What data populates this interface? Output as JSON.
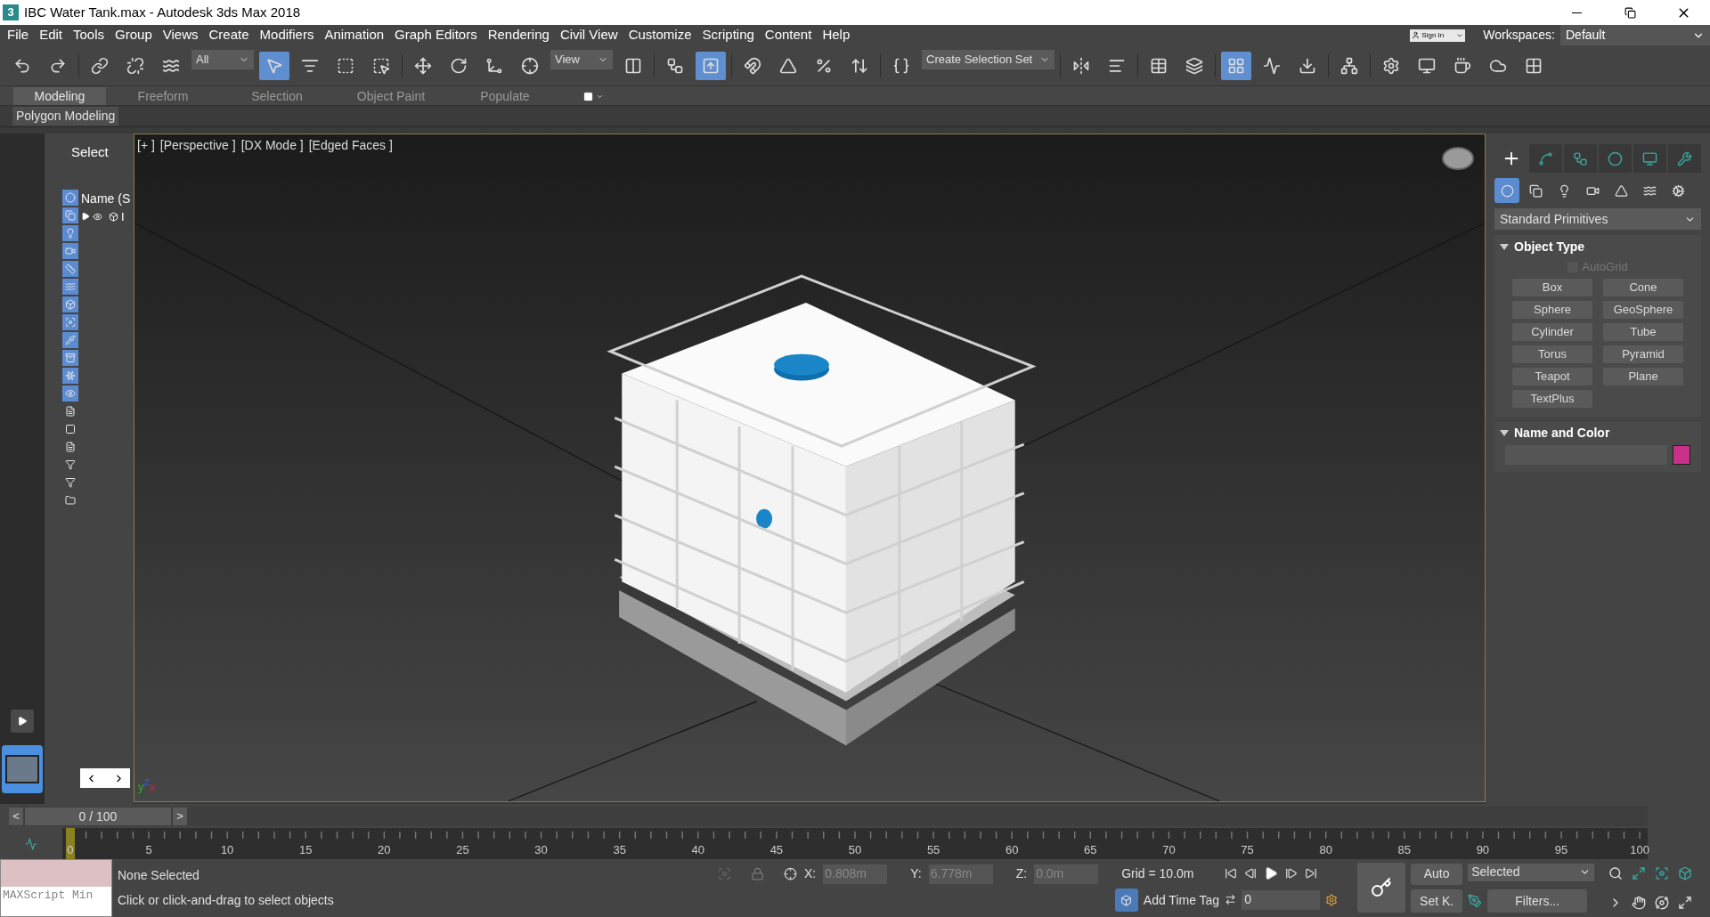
{
  "window": {
    "logo": "3",
    "title": "IBC Water Tank.max - Autodesk 3ds Max 2018"
  },
  "menu": [
    "File",
    "Edit",
    "Tools",
    "Group",
    "Views",
    "Create",
    "Modifiers",
    "Animation",
    "Graph Editors",
    "Rendering",
    "Civil View",
    "Customize",
    "Scripting",
    "Content",
    "Help"
  ],
  "account": {
    "sign_in": "Sign In",
    "workspaces_label": "Workspaces:",
    "workspace": "Default"
  },
  "toolbar": [
    {
      "kind": "tool",
      "selected": false
    },
    {
      "kind": "tool",
      "selected": false
    },
    {
      "kind": "divider"
    },
    {
      "kind": "tool",
      "selected": false
    },
    {
      "kind": "tool",
      "selected": false
    },
    {
      "kind": "tool",
      "selected": false
    },
    {
      "kind": "dropdown",
      "value": "All"
    },
    {
      "kind": "tool",
      "selected": true
    },
    {
      "kind": "tool",
      "selected": false
    },
    {
      "kind": "tool",
      "selected": false
    },
    {
      "kind": "tool",
      "selected": false
    },
    {
      "kind": "divider"
    },
    {
      "kind": "tool",
      "selected": false
    },
    {
      "kind": "tool",
      "selected": false
    },
    {
      "kind": "tool",
      "selected": false
    },
    {
      "kind": "tool",
      "selected": false
    },
    {
      "kind": "dropdown",
      "value": "View"
    },
    {
      "kind": "tool",
      "selected": false
    },
    {
      "kind": "divider"
    },
    {
      "kind": "tool",
      "selected": false
    },
    {
      "kind": "tool",
      "selected": true
    },
    {
      "kind": "divider"
    },
    {
      "kind": "tool",
      "selected": false
    },
    {
      "kind": "tool",
      "selected": false
    },
    {
      "kind": "tool",
      "selected": false
    },
    {
      "kind": "tool",
      "selected": false
    },
    {
      "kind": "divider"
    },
    {
      "kind": "tool",
      "selected": false
    },
    {
      "kind": "dropdown",
      "value": "Create Selection Set"
    },
    {
      "kind": "divider"
    },
    {
      "kind": "tool",
      "selected": false
    },
    {
      "kind": "tool",
      "selected": false
    },
    {
      "kind": "divider"
    },
    {
      "kind": "tool",
      "selected": false
    },
    {
      "kind": "tool",
      "selected": false
    },
    {
      "kind": "divider"
    },
    {
      "kind": "tool",
      "selected": true
    },
    {
      "kind": "tool",
      "selected": false
    },
    {
      "kind": "tool",
      "selected": false
    },
    {
      "kind": "divider"
    },
    {
      "kind": "tool",
      "selected": false
    },
    {
      "kind": "divider"
    },
    {
      "kind": "tool",
      "selected": false
    },
    {
      "kind": "tool",
      "selected": false
    },
    {
      "kind": "tool",
      "selected": false
    },
    {
      "kind": "tool",
      "selected": false
    },
    {
      "kind": "tool",
      "selected": false
    }
  ],
  "ribbon": {
    "tabs": [
      {
        "label": "Modeling",
        "selected": true
      },
      {
        "label": "Freeform",
        "selected": false
      },
      {
        "label": "Selection",
        "selected": false
      },
      {
        "label": "Object Paint",
        "selected": false
      },
      {
        "label": "Populate",
        "selected": false
      }
    ],
    "panel": "Polygon Modeling"
  },
  "scene_explorer": {
    "title": "Select",
    "column": "Name (S",
    "row": "I",
    "filters": [
      {
        "selected": true
      },
      {
        "selected": true
      },
      {
        "selected": true
      },
      {
        "selected": true
      },
      {
        "selected": true
      },
      {
        "selected": true
      },
      {
        "selected": true
      },
      {
        "selected": true
      },
      {
        "selected": true
      },
      {
        "selected": true
      },
      {
        "selected": true
      },
      {
        "selected": true
      },
      {
        "selected": false
      },
      {
        "selected": false
      },
      {
        "selected": false
      },
      {
        "selected": false
      },
      {
        "selected": false
      },
      {
        "selected": false
      }
    ]
  },
  "viewport": {
    "labels": [
      "[+ ]",
      "[Perspective ]",
      "[DX Mode ]",
      "[Edged Faces ]"
    ],
    "axes": [
      "y",
      "z",
      "x"
    ]
  },
  "command_panel": {
    "tabs": [
      {
        "selected": true
      },
      {
        "selected": false
      },
      {
        "selected": false
      },
      {
        "selected": false
      },
      {
        "selected": false
      },
      {
        "selected": false
      }
    ],
    "categories": [
      {
        "selected": true
      },
      {
        "selected": false
      },
      {
        "selected": false
      },
      {
        "selected": false
      },
      {
        "selected": false
      },
      {
        "selected": false
      },
      {
        "selected": false
      }
    ],
    "dropdown": "Standard Primitives",
    "object_type": {
      "title": "Object Type",
      "expanded": true,
      "autogrid": {
        "label": "AutoGrid",
        "checked": false
      },
      "buttons": [
        "Box",
        "Cone",
        "Sphere",
        "GeoSphere",
        "Cylinder",
        "Tube",
        "Torus",
        "Pyramid",
        "Teapot",
        "Plane",
        "TextPlus"
      ]
    },
    "name_and_color": {
      "title": "Name and Color",
      "expanded": true,
      "color": "#c8308a"
    }
  },
  "time_slider": {
    "label": "0 / 100",
    "prev": "<",
    "next": ">"
  },
  "ruler": [
    "0",
    "5",
    "10",
    "15",
    "20",
    "25",
    "30",
    "35",
    "40",
    "45",
    "50",
    "55",
    "60",
    "65",
    "70",
    "75",
    "80",
    "85",
    "90",
    "95",
    "100"
  ],
  "status": {
    "listener": "MAXScript Min",
    "selection": "None Selected",
    "prompt": "Click or click-and-drag to select objects",
    "x_label": "X:",
    "x": "0.808m",
    "y_label": "Y:",
    "y": "6.778m",
    "z_label": "Z:",
    "z": "0.0m",
    "grid": "Grid = 10.0m",
    "time_tag": "Add Time Tag",
    "frame": "0",
    "auto": "Auto",
    "set_key": "Set K.",
    "key_filter": "Selected",
    "filters": "Filters..."
  }
}
